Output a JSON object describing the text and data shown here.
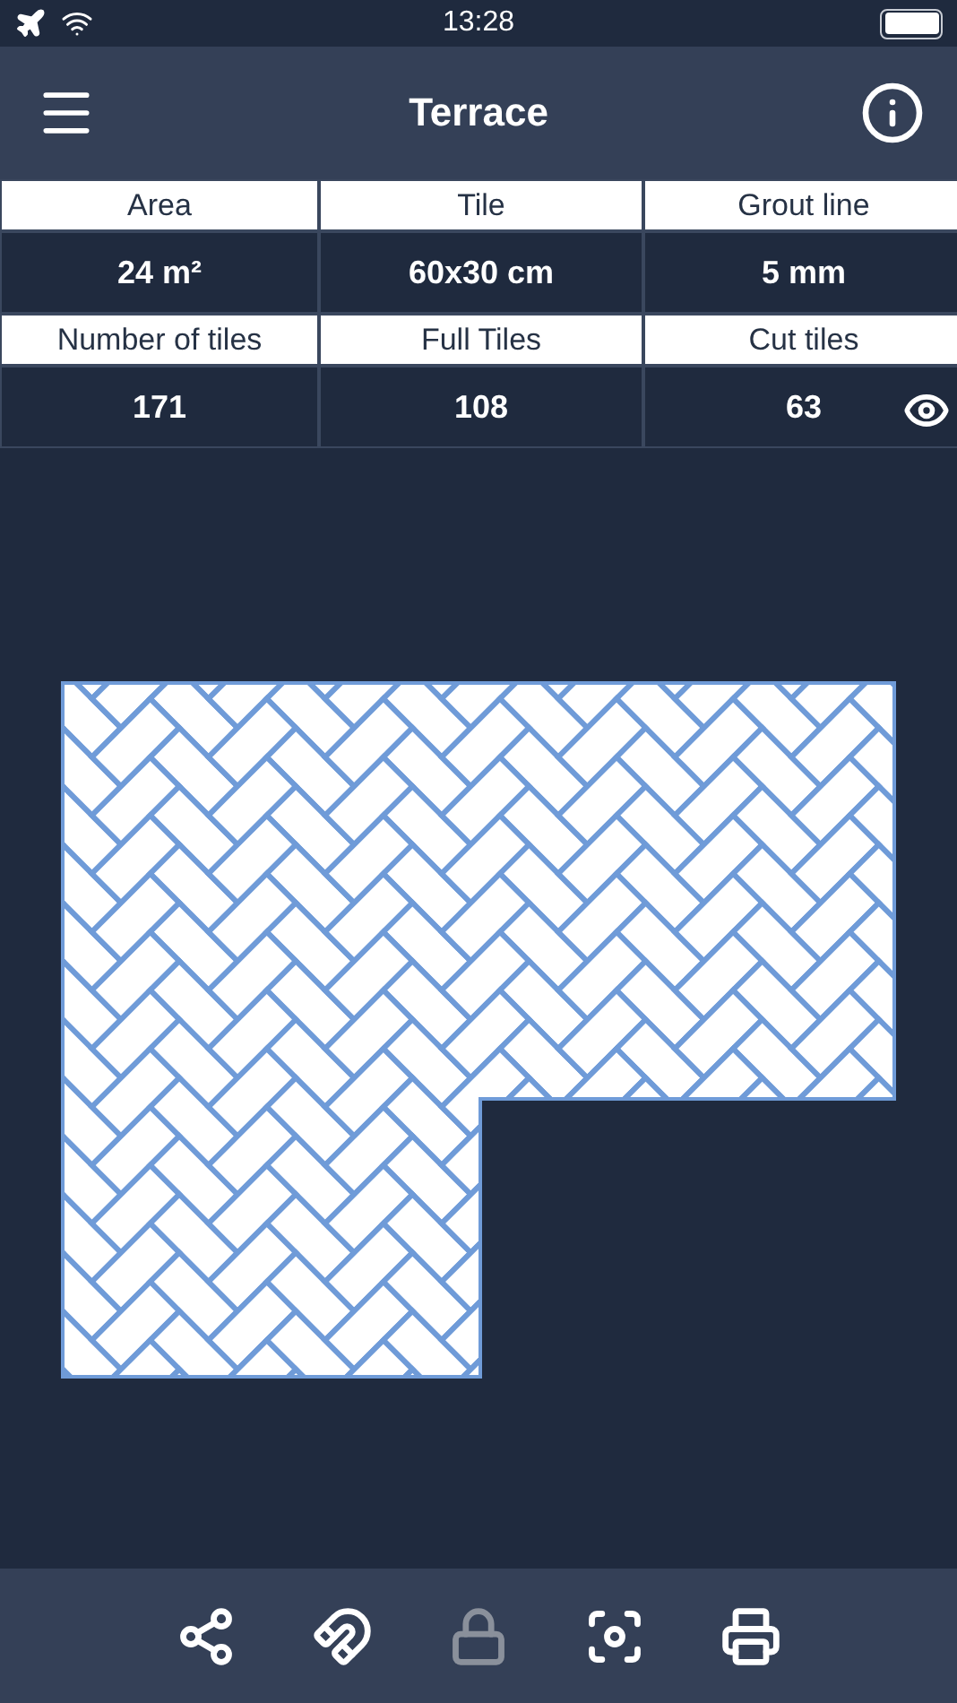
{
  "status_bar": {
    "time": "13:28"
  },
  "header": {
    "title": "Terrace"
  },
  "stats": [
    {
      "label": "Area",
      "value": "24 m²",
      "kind": "plain"
    },
    {
      "label": "Tile",
      "value": "60x30 cm",
      "kind": "plain"
    },
    {
      "label": "Grout line",
      "value": "5 mm",
      "kind": "plain"
    },
    {
      "label": "Number of tiles",
      "value": "171",
      "kind": "plain"
    },
    {
      "label": "Full Tiles",
      "value": "108",
      "kind": "plain"
    },
    {
      "label": "Cut tiles",
      "value": "63",
      "kind": "viewable"
    }
  ],
  "toolbar": [
    {
      "kind": "share",
      "disabled": false
    },
    {
      "kind": "magnet",
      "disabled": false
    },
    {
      "kind": "lock",
      "disabled": true
    },
    {
      "kind": "capture",
      "disabled": false
    },
    {
      "kind": "print",
      "disabled": false
    }
  ]
}
